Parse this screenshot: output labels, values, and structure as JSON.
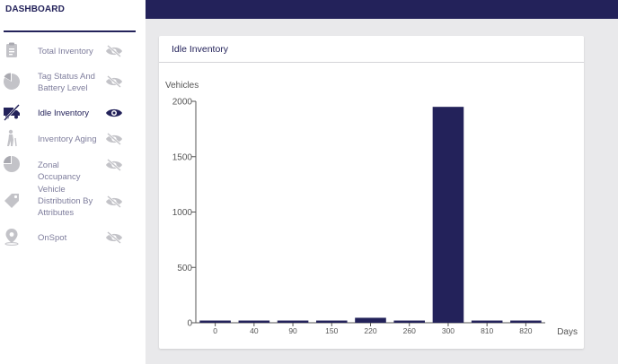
{
  "sidebar": {
    "title": "DASHBOARD",
    "items": [
      {
        "label": "Total Inventory",
        "active": false,
        "icon": "clipboard-icon"
      },
      {
        "label": "Tag Status And Battery Level",
        "active": false,
        "icon": "pie-chart-icon"
      },
      {
        "label": "Idle Inventory",
        "active": true,
        "icon": "truck-slash-icon"
      },
      {
        "label": "Inventory Aging",
        "active": false,
        "icon": "elderly-person-icon"
      },
      {
        "label": "Zonal Occupancy",
        "active": false,
        "icon": "quarter-pie-icon"
      },
      {
        "label": "Vehicle Distribution By Attributes",
        "active": false,
        "icon": "tag-icon"
      },
      {
        "label": "OnSpot",
        "active": false,
        "icon": "map-pin-icon"
      }
    ]
  },
  "colors": {
    "primary": "#23225a",
    "muted": "#c3c3c8",
    "background": "#e9e9eb"
  },
  "card": {
    "title": "Idle Inventory"
  },
  "chart_data": {
    "type": "bar",
    "categories": [
      "0",
      "40",
      "90",
      "150",
      "220",
      "260",
      "300",
      "810",
      "820"
    ],
    "values": [
      20,
      20,
      20,
      20,
      45,
      20,
      1950,
      20,
      20
    ],
    "ylabel": "Vehicles",
    "xlabel": "Days",
    "ylim": [
      0,
      2000
    ],
    "yticks": [
      0,
      500,
      1000,
      1500,
      2000
    ],
    "grid": false,
    "bar_color": "#23225a"
  }
}
